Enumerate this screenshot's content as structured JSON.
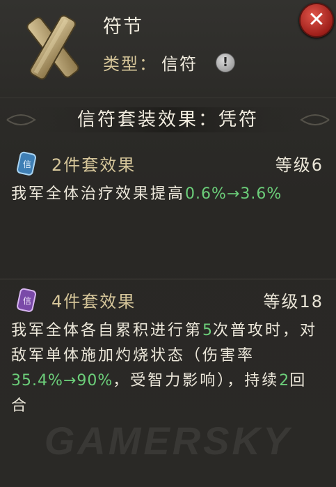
{
  "item": {
    "name": "符节",
    "type_label": "类型：",
    "type_value": "信符",
    "info_icon": "exclamation-icon",
    "close_icon": "close-x-icon"
  },
  "set": {
    "title": "信符套装效果：凭符"
  },
  "effects": [
    {
      "title": "2件套效果",
      "level": "等级6",
      "badge_color": "#5fa3d6",
      "text_a": "我军全体治疗效果提高",
      "value": "0.6%→3.6%",
      "text_b": ""
    },
    {
      "title": "4件套效果",
      "level": "等级18",
      "badge_color": "#b07ad6",
      "text_a": "我军全体各自累积进行第",
      "num": "5",
      "text_b": "次普攻时，对敌军单体施加灼烧状态（伤害率",
      "value": "35.4%→90%",
      "text_c": "，受智力影响），持续",
      "num2": "2",
      "text_d": "回合"
    }
  ],
  "watermark": "GAMERSKY",
  "colors": {
    "highlight": "#6ccf7a",
    "gold_label": "#d6c69a",
    "close_red": "#c0302a"
  }
}
